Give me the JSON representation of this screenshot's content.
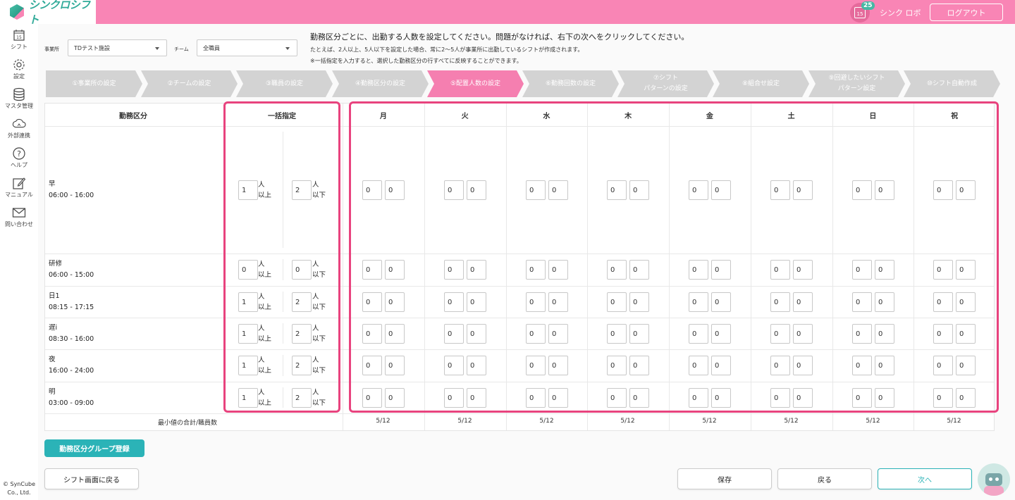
{
  "header": {
    "app_name": "シンクロシフト",
    "calendar_day": "15",
    "notification_count": "25",
    "user_name": "シンク ロボ",
    "logout_label": "ログアウト"
  },
  "sidebar": {
    "items": [
      {
        "label": "シフト",
        "icon": "calendar-icon"
      },
      {
        "label": "設定",
        "icon": "gear-icon"
      },
      {
        "label": "マスタ管理",
        "icon": "database-icon"
      },
      {
        "label": "外部連携",
        "icon": "cloud-icon"
      },
      {
        "label": "ヘルプ",
        "icon": "help-icon"
      },
      {
        "label": "マニュアル",
        "icon": "pencil-icon"
      },
      {
        "label": "問い合わせ",
        "icon": "mail-icon"
      }
    ],
    "calendar_icon_day": "15",
    "copyright_line1": "© SynCube",
    "copyright_line2": "Co., Ltd."
  },
  "filters": {
    "office_label": "事業所",
    "office_value": "TDテスト施設",
    "team_label": "チーム",
    "team_value": "全職員"
  },
  "instructions": {
    "main": "勤務区分ごとに、出勤する人数を設定してください。問題がなければ、右下の次へをクリックしてください。",
    "example": "たとえば、2人以上、5人以下を設定した場合、常に2〜5人が事業所に出勤しているシフトが作成されます。",
    "note": "※一括指定を入力すると、選択した勤務区分の行すべてに反映することができます。"
  },
  "steps": [
    {
      "line1": "①事業所の設定",
      "line2": ""
    },
    {
      "line1": "②チームの設定",
      "line2": ""
    },
    {
      "line1": "③職員の設定",
      "line2": ""
    },
    {
      "line1": "④勤務区分の設定",
      "line2": ""
    },
    {
      "line1": "⑤配置人数の設定",
      "line2": ""
    },
    {
      "line1": "⑥勤務回数の設定",
      "line2": ""
    },
    {
      "line1": "⑦シフト",
      "line2": "パターンの設定"
    },
    {
      "line1": "⑧組合せ設定",
      "line2": ""
    },
    {
      "line1": "⑨回避したいシフト",
      "line2": "パターン設定"
    },
    {
      "line1": "⑩シフト自動作成",
      "line2": ""
    }
  ],
  "active_step_index": 4,
  "table": {
    "col_shift": "勤務区分",
    "col_bulk": "一括指定",
    "days": [
      "月",
      "火",
      "水",
      "木",
      "金",
      "土",
      "日",
      "祝"
    ],
    "unit_min_1": "人",
    "unit_min_2": "以上",
    "unit_max_1": "人",
    "unit_max_2": "以下",
    "rows": [
      {
        "name": "早",
        "time": "06:00 - 16:00",
        "bulk_min": "1",
        "bulk_max": "2",
        "day_min": "0",
        "day_max": "0"
      },
      {
        "name": "研修",
        "time": "06:00 - 15:00",
        "bulk_min": "0",
        "bulk_max": "0",
        "day_min": "0",
        "day_max": "0"
      },
      {
        "name": "日1",
        "time": "08:15 - 17:15",
        "bulk_min": "1",
        "bulk_max": "2",
        "day_min": "0",
        "day_max": "0"
      },
      {
        "name": "遅i",
        "time": "08:30 - 16:00",
        "bulk_min": "1",
        "bulk_max": "2",
        "day_min": "0",
        "day_max": "0"
      },
      {
        "name": "夜",
        "time": "16:00 - 24:00",
        "bulk_min": "1",
        "bulk_max": "2",
        "day_min": "0",
        "day_max": "0"
      },
      {
        "name": "明",
        "time": "03:00 - 09:00",
        "bulk_min": "1",
        "bulk_max": "2",
        "day_min": "0",
        "day_max": "0"
      }
    ],
    "summary_label": "最小値の合計/職員数",
    "summary_values": [
      "5/12",
      "5/12",
      "5/12",
      "5/12",
      "5/12",
      "5/12",
      "5/12",
      "5/12"
    ]
  },
  "buttons": {
    "group_register": "勤務区分グループ登録",
    "back_to_shift": "シフト画面に戻る",
    "save": "保存",
    "back": "戻る",
    "next": "次へ"
  },
  "colors": {
    "brand_pink": "#f985b5",
    "active_step": "#f57fb0",
    "teal": "#2bb3b7",
    "highlight": "#e8437e"
  }
}
